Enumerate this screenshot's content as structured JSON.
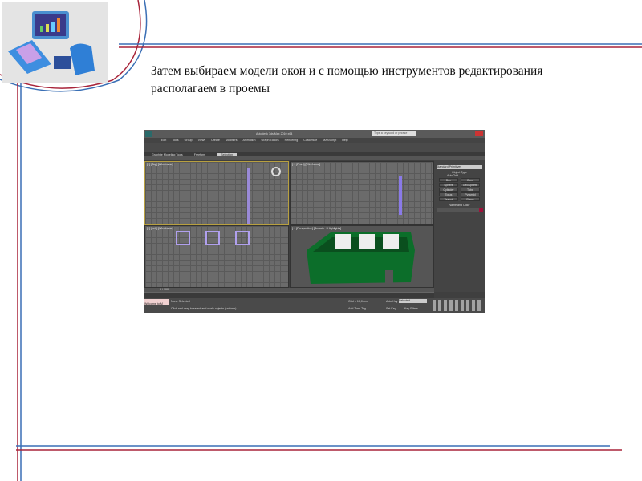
{
  "slide": {
    "caption": "Затем выбираем модели окон и с помощью инструментов редактирования располагаем в проемы"
  },
  "colors": {
    "line_red": "#a8243a",
    "line_blue": "#3a6fb5",
    "walls": "#0c6e2a"
  },
  "app": {
    "title": "Autodesk 3ds Max 2010 x64",
    "search_placeholder": "Type a keyword or phrase",
    "menu": [
      "Edit",
      "Tools",
      "Group",
      "Views",
      "Create",
      "Modifiers",
      "Animation",
      "Graph Editors",
      "Rendering",
      "Customize",
      "MAXScript",
      "Help"
    ],
    "ribbon_tabs": [
      "Graphite Modeling Tools",
      "Freeform",
      "Selection"
    ],
    "viewports": [
      "[+] [Top] [Wireframe]",
      "[+] [Front] [Wireframe]",
      "[+] [Left] [Wireframe]",
      "[+] [Perspective] [Smooth + Highlights]"
    ],
    "command_panel": {
      "dropdown": "Standard Primitives",
      "object_type": "Object Type",
      "autogrid": "AutoGrid",
      "buttons": [
        "Box",
        "Cone",
        "Sphere",
        "GeoSphere",
        "Cylinder",
        "Tube",
        "Torus",
        "Pyramid",
        "Teapot",
        "Plane"
      ],
      "name_color": "Name and Color"
    },
    "timeline": {
      "frame": "0 / 100"
    },
    "status": {
      "welcome": "Welcome to M",
      "selection": "None Selected",
      "prompt": "Click and drag to select and scale objects (uniform)",
      "grid": "Grid = 10,0mm",
      "add_time_tag": "Add Time Tag",
      "auto_key": "Auto Key",
      "set_key": "Set Key",
      "selected": "Selected",
      "key_filters": "Key Filters..."
    }
  }
}
